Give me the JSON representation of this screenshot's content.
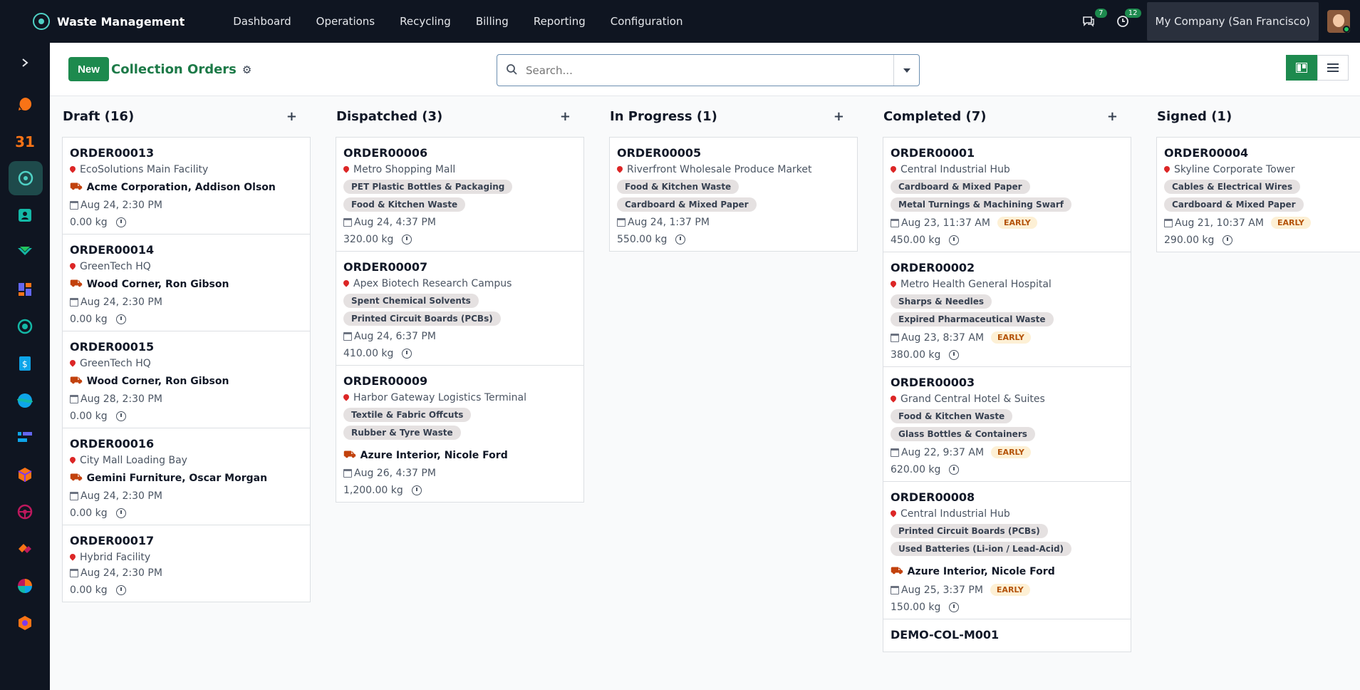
{
  "app": {
    "name": "Waste Management"
  },
  "menu": [
    "Dashboard",
    "Operations",
    "Recycling",
    "Billing",
    "Reporting",
    "Configuration"
  ],
  "topbar": {
    "messages_count": "7",
    "activities_count": "12",
    "company": "My Company (San Francisco)"
  },
  "controls": {
    "new_label": "New",
    "title": "Collection Orders",
    "search_placeholder": "Search..."
  },
  "sidebar_icons": [
    "expand-icon",
    "chat-app-icon",
    "calendar-app-icon",
    "waste-app-icon",
    "contacts-app-icon",
    "crm-app-icon",
    "dashboards-app-icon",
    "helpdesk-app-icon",
    "sales-app-icon",
    "discuss-app-icon",
    "project-app-icon",
    "inventory-app-icon",
    "fleet-app-icon",
    "sign-app-icon",
    "reporting-app-icon",
    "apps-app-icon"
  ],
  "calendar_icon_text": "31",
  "columns": [
    {
      "title": "Draft (16)",
      "cards": [
        {
          "ref": "ORDER00013",
          "location": "EcoSolutions Main Facility",
          "tags": [],
          "vehicle": "Acme Corporation, Addison Olson",
          "date": "Aug 24, 2:30 PM",
          "early": "",
          "weight": "0.00 kg"
        },
        {
          "ref": "ORDER00014",
          "location": "GreenTech HQ",
          "tags": [],
          "vehicle": "Wood Corner, Ron Gibson",
          "date": "Aug 24, 2:30 PM",
          "early": "",
          "weight": "0.00 kg"
        },
        {
          "ref": "ORDER00015",
          "location": "GreenTech HQ",
          "tags": [],
          "vehicle": "Wood Corner, Ron Gibson",
          "date": "Aug 28, 2:30 PM",
          "early": "",
          "weight": "0.00 kg"
        },
        {
          "ref": "ORDER00016",
          "location": "City Mall Loading Bay",
          "tags": [],
          "vehicle": "Gemini Furniture, Oscar Morgan",
          "date": "Aug 24, 2:30 PM",
          "early": "",
          "weight": "0.00 kg"
        },
        {
          "ref": "ORDER00017",
          "location": "Hybrid Facility",
          "tags": [],
          "vehicle": "",
          "date": "Aug 24, 2:30 PM",
          "early": "",
          "weight": "0.00 kg"
        }
      ]
    },
    {
      "title": "Dispatched (3)",
      "cards": [
        {
          "ref": "ORDER00006",
          "location": "Metro Shopping Mall",
          "tags": [
            "PET Plastic Bottles & Packaging",
            "Food & Kitchen Waste"
          ],
          "vehicle": "",
          "date": "Aug 24, 4:37 PM",
          "early": "",
          "weight": "320.00 kg"
        },
        {
          "ref": "ORDER00007",
          "location": "Apex Biotech Research Campus",
          "tags": [
            "Spent Chemical Solvents",
            "Printed Circuit Boards (PCBs)"
          ],
          "vehicle": "",
          "date": "Aug 24, 6:37 PM",
          "early": "",
          "weight": "410.00 kg"
        },
        {
          "ref": "ORDER00009",
          "location": "Harbor Gateway Logistics Terminal",
          "tags": [
            "Textile & Fabric Offcuts",
            "Rubber & Tyre Waste"
          ],
          "vehicle": "Azure Interior, Nicole Ford",
          "date": "Aug 26, 4:37 PM",
          "early": "",
          "weight": "1,200.00 kg"
        }
      ]
    },
    {
      "title": "In Progress (1)",
      "cards": [
        {
          "ref": "ORDER00005",
          "location": "Riverfront Wholesale Produce Market",
          "tags": [
            "Food & Kitchen Waste",
            "Cardboard & Mixed Paper"
          ],
          "vehicle": "",
          "date": "Aug 24, 1:37 PM",
          "early": "",
          "weight": "550.00 kg"
        }
      ]
    },
    {
      "title": "Completed (7)",
      "cards": [
        {
          "ref": "ORDER00001",
          "location": "Central Industrial Hub",
          "tags": [
            "Cardboard & Mixed Paper",
            "Metal Turnings & Machining Swarf"
          ],
          "vehicle": "",
          "date": "Aug 23, 11:37 AM",
          "early": "EARLY",
          "weight": "450.00 kg"
        },
        {
          "ref": "ORDER00002",
          "location": "Metro Health General Hospital",
          "tags": [
            "Sharps & Needles",
            "Expired Pharmaceutical Waste"
          ],
          "vehicle": "",
          "date": "Aug 23, 8:37 AM",
          "early": "EARLY",
          "weight": "380.00 kg"
        },
        {
          "ref": "ORDER00003",
          "location": "Grand Central Hotel & Suites",
          "tags": [
            "Food & Kitchen Waste",
            "Glass Bottles & Containers"
          ],
          "vehicle": "",
          "date": "Aug 22, 9:37 AM",
          "early": "EARLY",
          "weight": "620.00 kg"
        },
        {
          "ref": "ORDER00008",
          "location": "Central Industrial Hub",
          "tags": [
            "Printed Circuit Boards (PCBs)",
            "Used Batteries (Li-ion / Lead-Acid)"
          ],
          "vehicle": "Azure Interior, Nicole Ford",
          "date": "Aug 25, 3:37 PM",
          "early": "EARLY",
          "weight": "150.00 kg"
        },
        {
          "ref": "DEMO-COL-M001",
          "location": "",
          "tags": [],
          "vehicle": "",
          "date": "",
          "early": "",
          "weight": ""
        }
      ]
    },
    {
      "title": "Signed (1)",
      "cards": [
        {
          "ref": "ORDER00004",
          "location": "Skyline Corporate Tower",
          "tags": [
            "Cables & Electrical Wires",
            "Cardboard & Mixed Paper"
          ],
          "vehicle": "",
          "date": "Aug 21, 10:37 AM",
          "early": "EARLY",
          "weight": "290.00 kg"
        }
      ]
    }
  ]
}
